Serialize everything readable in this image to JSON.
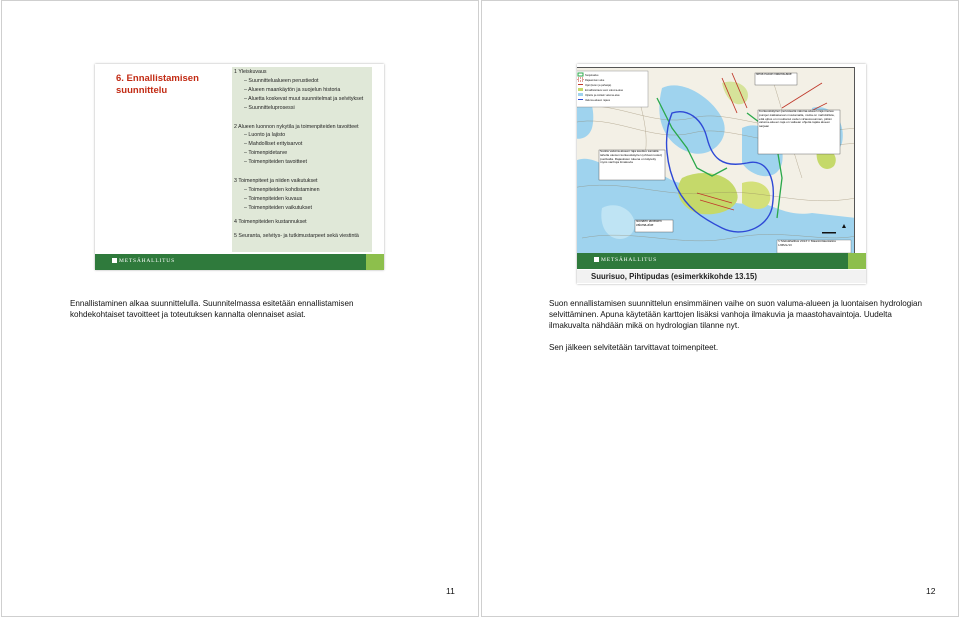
{
  "left_page": {
    "slide": {
      "title": "6. Ennallistamisen suunnittelu",
      "outline": [
        {
          "heading": "1 Yleiskuvaus",
          "items": [
            "– Suunnittelualueen perustiedot",
            "– Alueen maankäytön ja suojelun historia",
            "– Aluetta koskevat muut suunnitelmat ja selvitykset",
            "– Suunnitteluprosessi"
          ]
        },
        {
          "heading": "2 Alueen luonnon nykytila ja toimenpiteiden tavoitteet",
          "items": [
            "– Luonto ja lajisto",
            "– Mahdolliset erityisarvot",
            "– Toimenpidetarve",
            "– Toimenpiteiden tavoitteet"
          ]
        },
        {
          "heading": "3 Toimenpiteet ja niiden vaikutukset",
          "items": [
            "– Toimenpiteiden kohdistaminen",
            "– Toimenpiteiden kuvaus",
            "– Toimenpiteiden vaikutukset"
          ]
        },
        {
          "heading": "4 Toimenpiteiden kustannukset",
          "items": []
        },
        {
          "heading": "5 Seuranta, selvitys- ja tutkimustarpeet sekä viestintä",
          "items": []
        }
      ],
      "footer_logo": "METSÄHALLITUS"
    },
    "text": "Ennallistaminen alkaa suunnittelulla. Suunnitelmassa esitetään ennallistamisen kohdekohtaiset tavoitteet ja toteutuksen kannalta olennaiset asiat.",
    "page_number": "11"
  },
  "right_page": {
    "slide": {
      "map_legend": [
        "Suojelualue",
        "Rajaamisen alue",
        "Ojat (kuten ja pahaoja)",
        "Ennallistettava suon valuma-alue",
        "Ojitettu ja osittain valuma-alue",
        "Valuma-alueen rajaus"
      ],
      "callouts": {
        "top_right": "Neva Kukon valuma-alue",
        "right": "Korkeuskäyrien perusteella valuma-alueen raja menee purojen katkaisevan muutamalla, mutta on mahdollista, että ojitus on muuttanut veden virtaussuunnan, jolloin valuma-alueen raja on vaikean ohjetta rajata alueen sarjaan",
        "left": "Suolta valuma-alueen raja asettuu samalla taholla olevien korkeuskäyrien (ohivat nuolet) puolivalta. Rajauksien tukena on käytetty myös vanhoja ilmakuvia",
        "bottom": "Noinaen lähteiden valuma-alue",
        "copyright": "© Metsähallitus 2013 © Maanmittauslaitos 1/MML/13"
      },
      "caption": "Suurisuo, Pihtipudas (esimerkkikohde 13.15)",
      "footer_logo": "METSÄHALLITUS"
    },
    "paragraphs": [
      "Suon ennallistamisen suunnittelun ensimmäinen vaihe on suon valuma-alueen ja luontaisen hydrologian selvittäminen. Apuna käytetään karttojen lisäksi vanhoja ilmakuvia ja maastohavaintoja. Uudelta ilmakuvalta nähdään mikä on hydrologian tilanne nyt.",
      "Sen jälkeen selvitetään tarvittavat toimenpiteet."
    ],
    "page_number": "12"
  },
  "colors": {
    "title_red": "#c22b14",
    "footer_green": "#2f7a3c",
    "footer_accent": "#8dbf4c",
    "outline_bg": "#e0e8d8",
    "water": "#9fd3ee",
    "peat": "#c5d96a",
    "boundary_green": "#2aa84a",
    "ditch_red": "#c0392b",
    "catchment_blue": "#2e49d6"
  }
}
